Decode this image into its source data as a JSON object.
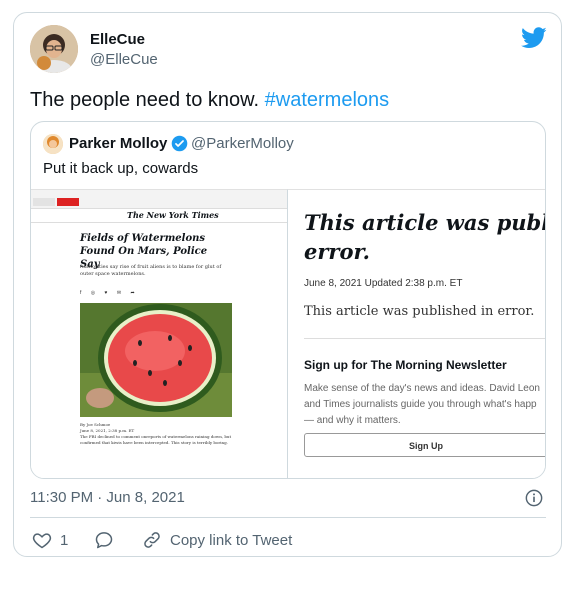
{
  "tweet": {
    "display_name": "ElleCue",
    "handle": "@ElleCue",
    "text": "The people need to know. ",
    "hashtag": "#watermelons",
    "timestamp": "11:30 PM · Jun 8, 2021",
    "likes": "1",
    "copy_link_label": "Copy link to Tweet"
  },
  "quote": {
    "display_name": "Parker Molloy",
    "handle": "@ParkerMolloy",
    "text": "Put it back up, cowards"
  },
  "nyt_left": {
    "logo": "The New York Times",
    "headline": "Fields of Watermelons Found On Mars, Police Say",
    "subhead": "Authorities say rise of fruit aliens is to blame for glut of outer space watermelons.",
    "byline": "By Joe Schmoe",
    "dateline": "June 8, 2021, 2:38 p.m. ET",
    "body": "The FBI declined to comment onreports of watermelons raining down, but confirmed that kiwis have been intercepted. This story is terribly boring."
  },
  "nyt_right": {
    "headline_line1": "This article was published",
    "headline_line2": "error.",
    "dates": "June 8, 2021    Updated 2:38 p.m. ET",
    "body": "This article was published in error.",
    "newsletter_title": "Sign up for The Morning Newsletter",
    "newsletter_line1": "Make sense of the day's news and ideas. David Leon",
    "newsletter_line2": "and Times journalists guide you through what's happ",
    "newsletter_line3": "— and why it matters.",
    "signup_label": "Sign Up"
  },
  "colors": {
    "accent": "#1d9bf0",
    "muted": "#536471",
    "border": "#cfd9de"
  }
}
